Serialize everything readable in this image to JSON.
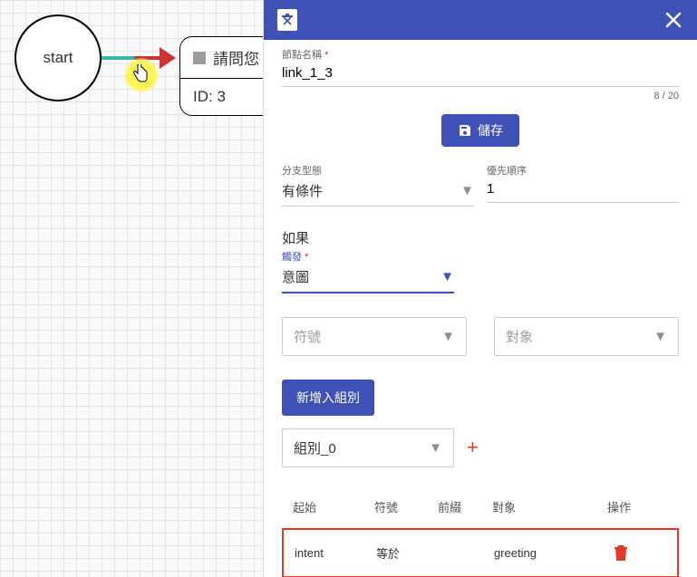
{
  "canvas": {
    "start_label": "start",
    "dest_title": "請問您",
    "dest_id_line": "ID: 3"
  },
  "panel": {
    "name_label": "節點名稱",
    "name_value": "link_1_3",
    "name_counter": "8 / 20",
    "save_label": "儲存",
    "branch_type_label": "分支型態",
    "branch_type_value": "有條件",
    "priority_label": "優先順序",
    "priority_value": "1",
    "if_label": "如果",
    "trigger_label": "觸發",
    "trigger_value": "意圖",
    "symbol_placeholder": "符號",
    "object_placeholder": "對象",
    "add_group_label": "新增入組別",
    "group_value": "組別_0",
    "table": {
      "headers": {
        "start": "起始",
        "symbol": "符號",
        "prefix": "前綴",
        "object": "對象",
        "action": "操作"
      },
      "row": {
        "start": "intent",
        "symbol": "等於",
        "prefix": "",
        "object": "greeting"
      }
    }
  }
}
